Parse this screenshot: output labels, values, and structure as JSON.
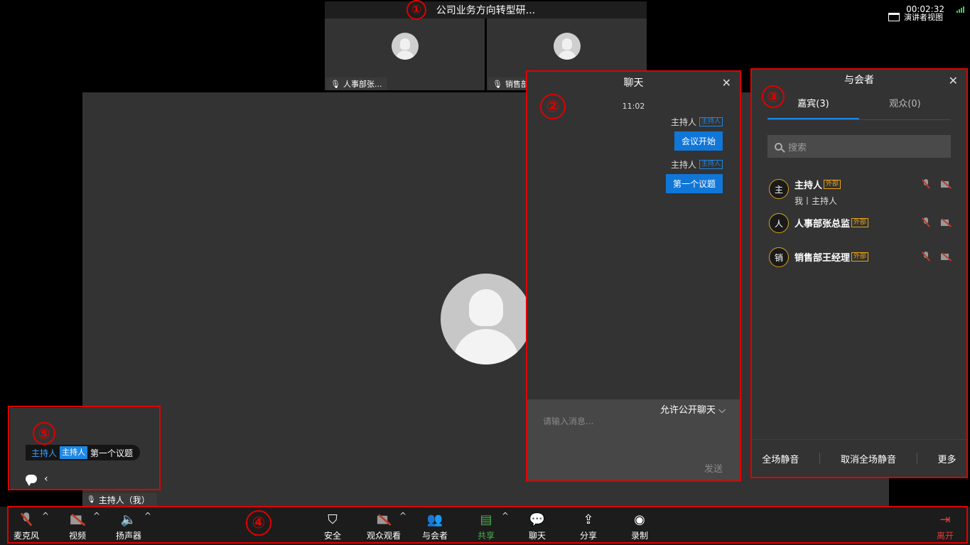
{
  "meeting": {
    "title": "公司业务方向转型研...",
    "timer": "00:02:32",
    "speaker_view": "演讲者视图",
    "thumbnails": [
      {
        "name": "人事部张..."
      },
      {
        "name": "销售部"
      }
    ],
    "self_name": "主持人（我）"
  },
  "chat": {
    "title": "聊天",
    "time": "11:02",
    "messages": [
      {
        "sender": "主持人",
        "tag": "主持人",
        "text": "会议开始"
      },
      {
        "sender": "主持人",
        "tag": "主持人",
        "text": "第一个议题"
      }
    ],
    "allow_label": "允许公开聊天",
    "placeholder": "请输入消息...",
    "send": "发送"
  },
  "participants": {
    "title": "与会者",
    "tabs": [
      "嘉宾(3)",
      "观众(0)"
    ],
    "search_placeholder": "搜索",
    "list": [
      {
        "initial": "主",
        "name": "主持人",
        "tag": "外部",
        "sub": "我丨主持人"
      },
      {
        "initial": "人",
        "name": "人事部张总监",
        "tag": "外部"
      },
      {
        "initial": "销",
        "name": "销售部王经理",
        "tag": "外部"
      }
    ],
    "footer": [
      "全场静音",
      "取消全场静音",
      "更多"
    ]
  },
  "preview": {
    "sender": "主持人",
    "tag": "主持人",
    "text": "第一个议题"
  },
  "toolbar": {
    "mic": "麦克风",
    "video": "视频",
    "speaker": "扬声器",
    "security": "安全",
    "audience": "观众观看",
    "participants": "与会者",
    "share": "共享",
    "chat": "聊天",
    "sharelink": "分享",
    "record": "录制",
    "leave": "离开"
  },
  "annotations": [
    "①",
    "②",
    "③",
    "④",
    "⑤"
  ],
  "colors": {
    "accent": "#1e88e5",
    "annotation": "#e00000",
    "share": "#4caf50",
    "leave": "#e53935"
  }
}
